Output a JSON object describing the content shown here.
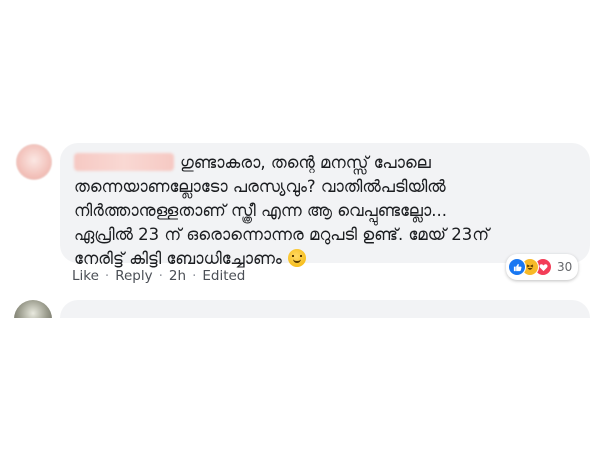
{
  "comment": {
    "lines": [
      "ഗുണ്ടാകരാ, തന്റെ മനസ്സ് പോലെ",
      "തന്നെയാണല്ലോടോ പരസ്യവും? വാതിൽപടിയിൽ",
      "നിർത്താനുള്ളതാണ് സ്ത്രീ എന്ന ആ വെപ്പുണ്ടല്ലോ...",
      "ഏപ്രിൽ 23 ന് ഒരൊന്നൊന്നര മറുപടി ഉണ്ട്. മേയ് 23ന്",
      "നേരിട്ട് കിട്ടി ബോധിച്ചോണം"
    ],
    "emoji": "smiling-face",
    "reactions": {
      "types": [
        "like-icon",
        "haha-icon",
        "love-icon"
      ],
      "count": "30"
    },
    "actions": {
      "like": "Like",
      "reply": "Reply",
      "time": "2h",
      "edited": "Edited",
      "separator": "·"
    }
  },
  "colors": {
    "bubble": "#f2f3f5",
    "text": "#1c1e21",
    "meta": "#90949c",
    "like": "#1877f2",
    "haha": "#f7b928",
    "love": "#f33e58"
  }
}
